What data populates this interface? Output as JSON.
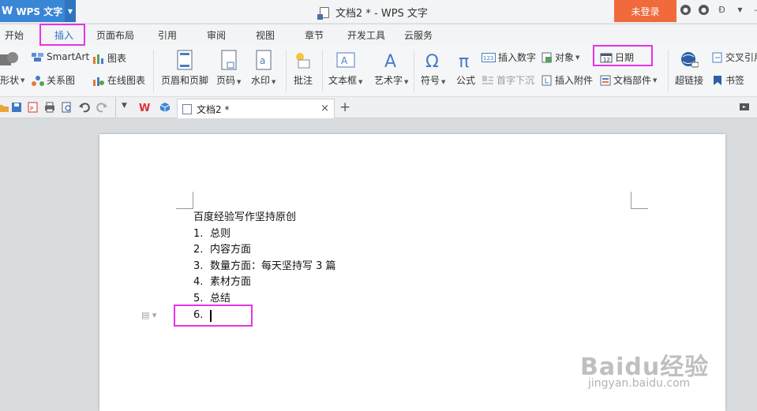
{
  "titlebar": {
    "app_logo": "W",
    "app_name": "WPS 文字",
    "doc_title": "文档2 * - WPS 文字",
    "login_label": "未登录"
  },
  "menu": {
    "tabs": [
      {
        "label": "开始"
      },
      {
        "label": "插入"
      },
      {
        "label": "页面布局"
      },
      {
        "label": "引用"
      },
      {
        "label": "审阅"
      },
      {
        "label": "视图"
      },
      {
        "label": "章节"
      },
      {
        "label": "开发工具"
      },
      {
        "label": "云服务"
      }
    ],
    "active_tab": "插入"
  },
  "ribbon": {
    "shapes": "形状",
    "smartart": "SmartArt",
    "chart": "图表",
    "relation": "关系图",
    "online_chart": "在线图表",
    "header_footer": "页眉和页脚",
    "page_number": "页码",
    "watermark": "水印",
    "comment": "批注",
    "textbox": "文本框",
    "wordart": "艺术字",
    "symbol": "符号",
    "formula": "公式",
    "insert_number": "插入数字",
    "object": "对象",
    "date": "日期",
    "drop_cap": "首字下沉",
    "insert_attachment": "插入附件",
    "doc_parts": "文档部件",
    "hyperlink": "超链接",
    "cross_ref": "交叉引用",
    "bookmark": "书签"
  },
  "quickbar": {
    "doc_tab": "文档2 *"
  },
  "document": {
    "heading": "百度经验写作坚持原创",
    "items": [
      {
        "num": "1.",
        "text": "总则"
      },
      {
        "num": "2.",
        "text": "内容方面"
      },
      {
        "num": "3.",
        "text": "数量方面：每天坚持写 3 篇"
      },
      {
        "num": "4.",
        "text": "素材方面"
      },
      {
        "num": "5.",
        "text": "总结"
      },
      {
        "num": "6.",
        "text": ""
      }
    ]
  },
  "watermark": {
    "line1": "Baidu经验",
    "line2": "jingyan.baidu.com"
  },
  "colors": {
    "highlight": "#e832e8",
    "accent": "#2a6fc9",
    "login": "#f06a3c",
    "app": "#3a86d6"
  }
}
